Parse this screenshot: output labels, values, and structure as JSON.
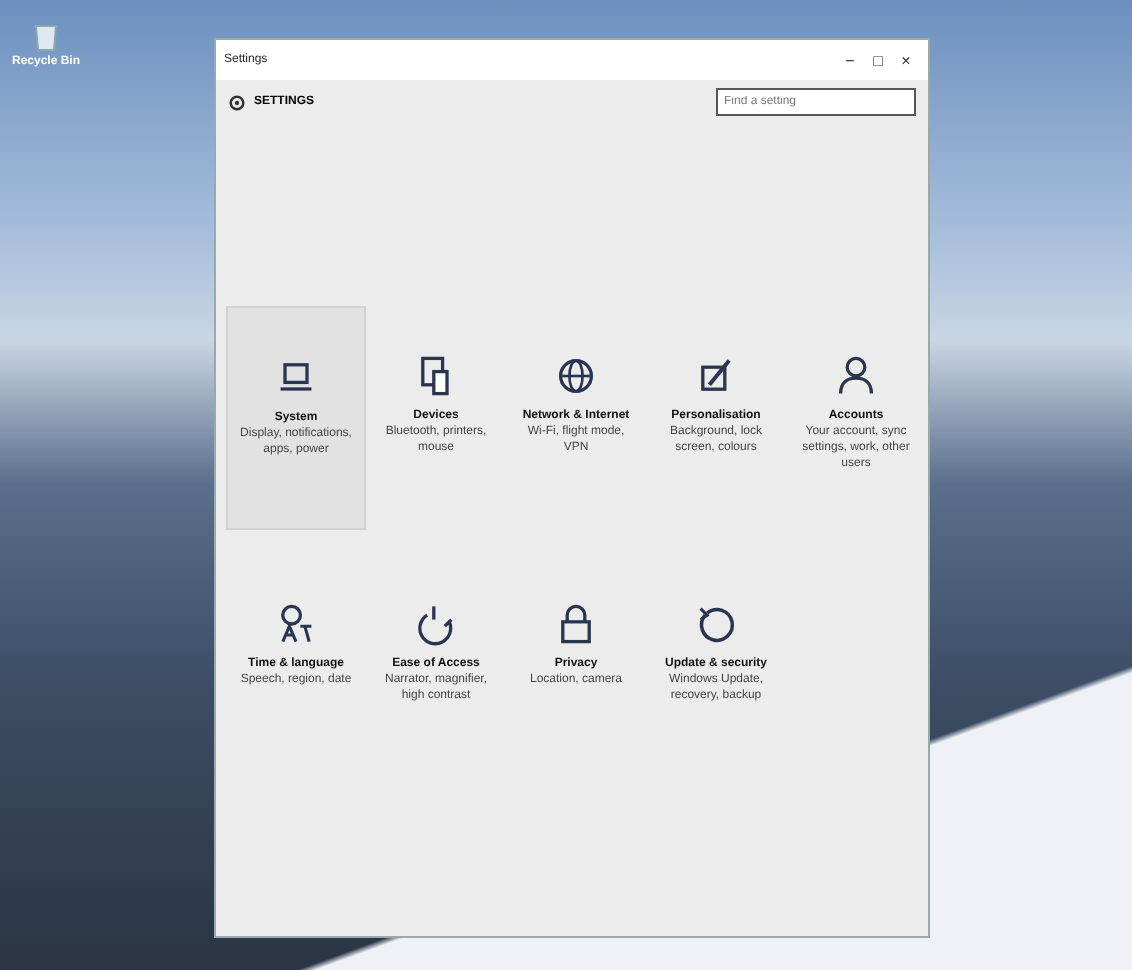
{
  "desktop": {
    "icons": [
      {
        "label": "Recycle Bin"
      }
    ]
  },
  "window": {
    "title": "Settings",
    "controls": [
      "−",
      "□",
      "×"
    ]
  },
  "header": {
    "title": "SETTINGS",
    "search": {
      "placeholder": "Find a setting"
    }
  },
  "categories": [
    {
      "name": "System",
      "description": "Display, notifications, apps, power",
      "selected": true
    },
    {
      "name": "Devices",
      "description": "Bluetooth, printers, mouse",
      "selected": false
    },
    {
      "name": "Network & Internet",
      "description": "Wi-Fi, flight mode, VPN",
      "selected": false
    },
    {
      "name": "Personalisation",
      "description": "Background, lock screen, colours",
      "selected": false
    },
    {
      "name": "Accounts",
      "description": "Your account, sync settings, work, other users",
      "selected": false
    },
    {
      "name": "Time & language",
      "description": "Speech, region, date",
      "selected": false
    },
    {
      "name": "Ease of Access",
      "description": "Narrator, magnifier, high contrast",
      "selected": false
    },
    {
      "name": "Privacy",
      "description": "Location, camera",
      "selected": false
    },
    {
      "name": "Update & security",
      "description": "Windows Update, recovery, backup",
      "selected": false
    }
  ]
}
